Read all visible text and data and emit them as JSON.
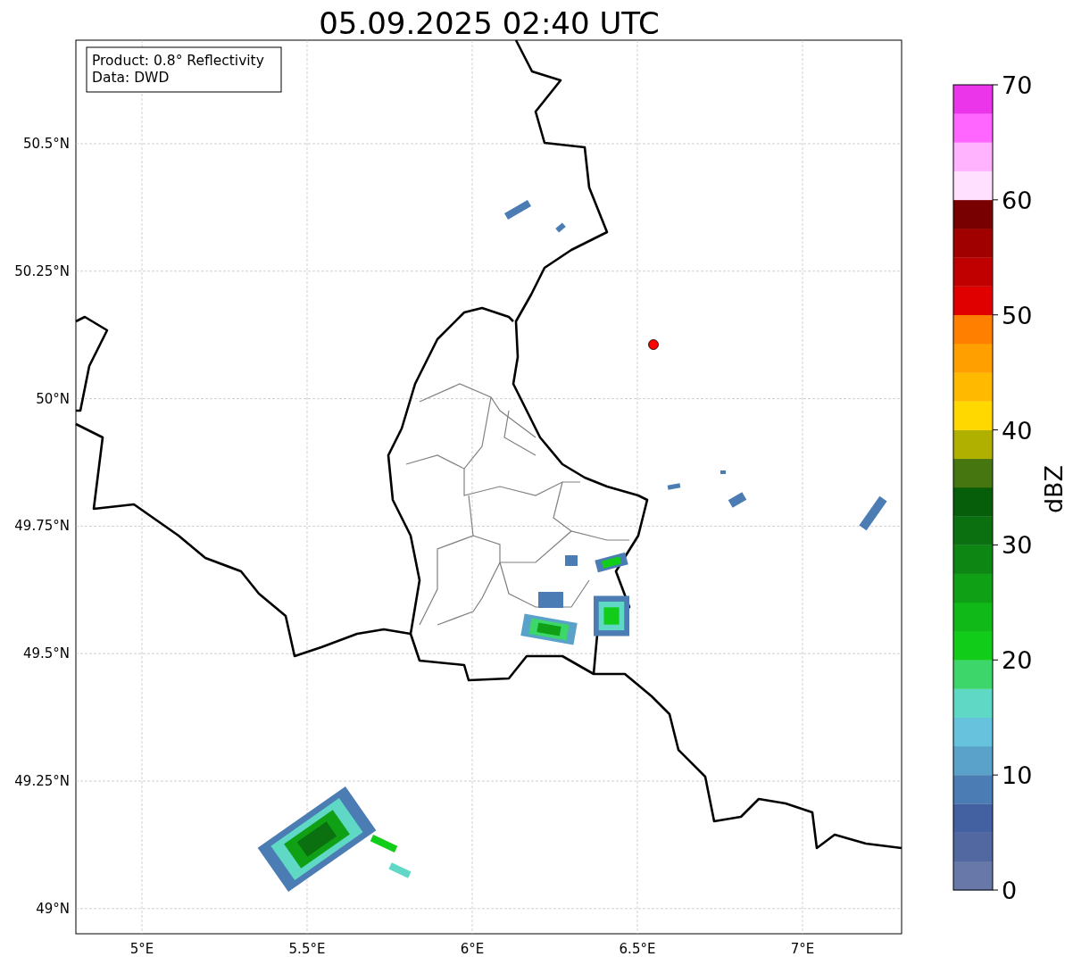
{
  "title": "05.09.2025 02:40 UTC",
  "info_box": {
    "lines": [
      "Product: 0.8° Reflectivity",
      "Data: DWD"
    ]
  },
  "map": {
    "lat_labels": [
      "50.5°N",
      "50.25°N",
      "50°N",
      "49.75°N",
      "49.5°N",
      "49.25°N",
      "49°N"
    ],
    "lon_labels": [
      "5°E",
      "5.5°E",
      "6°E",
      "6.5°E",
      "7°E"
    ]
  },
  "colorbar": {
    "label": "dBZ",
    "ticks": [
      "70",
      "60",
      "50",
      "40",
      "30",
      "20",
      "10",
      "0"
    ],
    "bins": [
      {
        "color": "#6878a8"
      },
      {
        "color": "#5268a0"
      },
      {
        "color": "#4360a0"
      },
      {
        "color": "#4b7cb3"
      },
      {
        "color": "#5aa2c9"
      },
      {
        "color": "#66c2dd"
      },
      {
        "color": "#5fd8c5"
      },
      {
        "color": "#3cd66a"
      },
      {
        "color": "#12cc1a"
      },
      {
        "color": "#10b818"
      },
      {
        "color": "#10a015"
      },
      {
        "color": "#0e8613"
      },
      {
        "color": "#0b700f"
      },
      {
        "color": "#075e0a"
      },
      {
        "color": "#467610"
      },
      {
        "color": "#b0b000"
      },
      {
        "color": "#ffd800"
      },
      {
        "color": "#ffba00"
      },
      {
        "color": "#ff9f00"
      },
      {
        "color": "#ff8000"
      },
      {
        "color": "#e00000"
      },
      {
        "color": "#c00000"
      },
      {
        "color": "#a00000"
      },
      {
        "color": "#780000"
      },
      {
        "color": "#ffe0ff"
      },
      {
        "color": "#ffb3ff"
      },
      {
        "color": "#ff66ff"
      },
      {
        "color": "#ea35ea"
      }
    ]
  }
}
